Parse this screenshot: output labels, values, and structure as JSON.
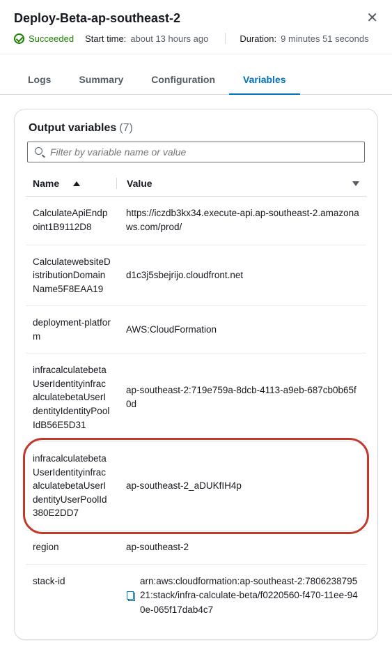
{
  "header": {
    "title": "Deploy-Beta-ap-southeast-2",
    "status": "Succeeded",
    "start_label": "Start time:",
    "start_value": "about 13 hours ago",
    "duration_label": "Duration:",
    "duration_value": "9 minutes 51 seconds"
  },
  "tabs": [
    {
      "label": "Logs",
      "active": false
    },
    {
      "label": "Summary",
      "active": false
    },
    {
      "label": "Configuration",
      "active": false
    },
    {
      "label": "Variables",
      "active": true
    }
  ],
  "panel": {
    "title": "Output variables",
    "count": "(7)",
    "search_placeholder": "Filter by variable name or value",
    "columns": {
      "name": "Name",
      "value": "Value"
    },
    "rows": [
      {
        "name": "CalculateApiEndpoint1B9112D8",
        "value": "https://iczdb3kx34.execute-api.ap-southeast-2.amazonaws.com/prod/",
        "copy": false,
        "highlight": false
      },
      {
        "name": "CalculatewebsiteDistributionDomainName5F8EAA19",
        "value": "d1c3j5sbejrijo.cloudfront.net",
        "copy": false,
        "highlight": false
      },
      {
        "name": "deployment-platform",
        "value": "AWS:CloudFormation",
        "copy": false,
        "highlight": false
      },
      {
        "name": "infracalculatebetaUserIdentityinfracalculatebetaUserIdentityIdentityPoolIdB56E5D31",
        "value": "ap-southeast-2:719e759a-8dcb-4113-a9eb-687cb0b65f0d",
        "copy": false,
        "highlight": false
      },
      {
        "name": "infracalculatebetaUserIdentityinfracalculatebetaUserIdentityUserPoolId380E2DD7",
        "value": "ap-southeast-2_aDUKfIH4p",
        "copy": false,
        "highlight": true
      },
      {
        "name": "region",
        "value": "ap-southeast-2",
        "copy": false,
        "highlight": false
      },
      {
        "name": "stack-id",
        "value": "arn:aws:cloudformation:ap-southeast-2:780623879521:stack/infra-calculate-beta/f0220560-f470-11ee-940e-065f17dab4c7",
        "copy": true,
        "highlight": false
      }
    ]
  }
}
